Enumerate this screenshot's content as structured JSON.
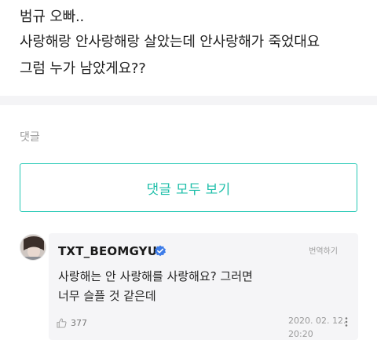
{
  "post": {
    "lines": [
      "범규 오빠..",
      "사랑해랑 안사랑해랑 살았는데 안사랑해가 죽었대요",
      "그럼 누가 남았게요??"
    ]
  },
  "comments_section": {
    "label": "댓글",
    "view_all_label": "댓글 모두 보기"
  },
  "reply": {
    "author": "TXT_BEOMGYU",
    "verified_icon": "verified-badge-icon",
    "translate_label": "번역하기",
    "text_lines": [
      "사랑해는 안 사랑해를 사랑해요? 그러면",
      "너무 슬플 것 같은데"
    ],
    "like_count": "377",
    "date": "2020. 02. 12.",
    "time": "20:20"
  },
  "colors": {
    "accent": "#1fbfaa",
    "verified": "#3d7ce8",
    "bubble_bg": "#f5f5f7"
  }
}
